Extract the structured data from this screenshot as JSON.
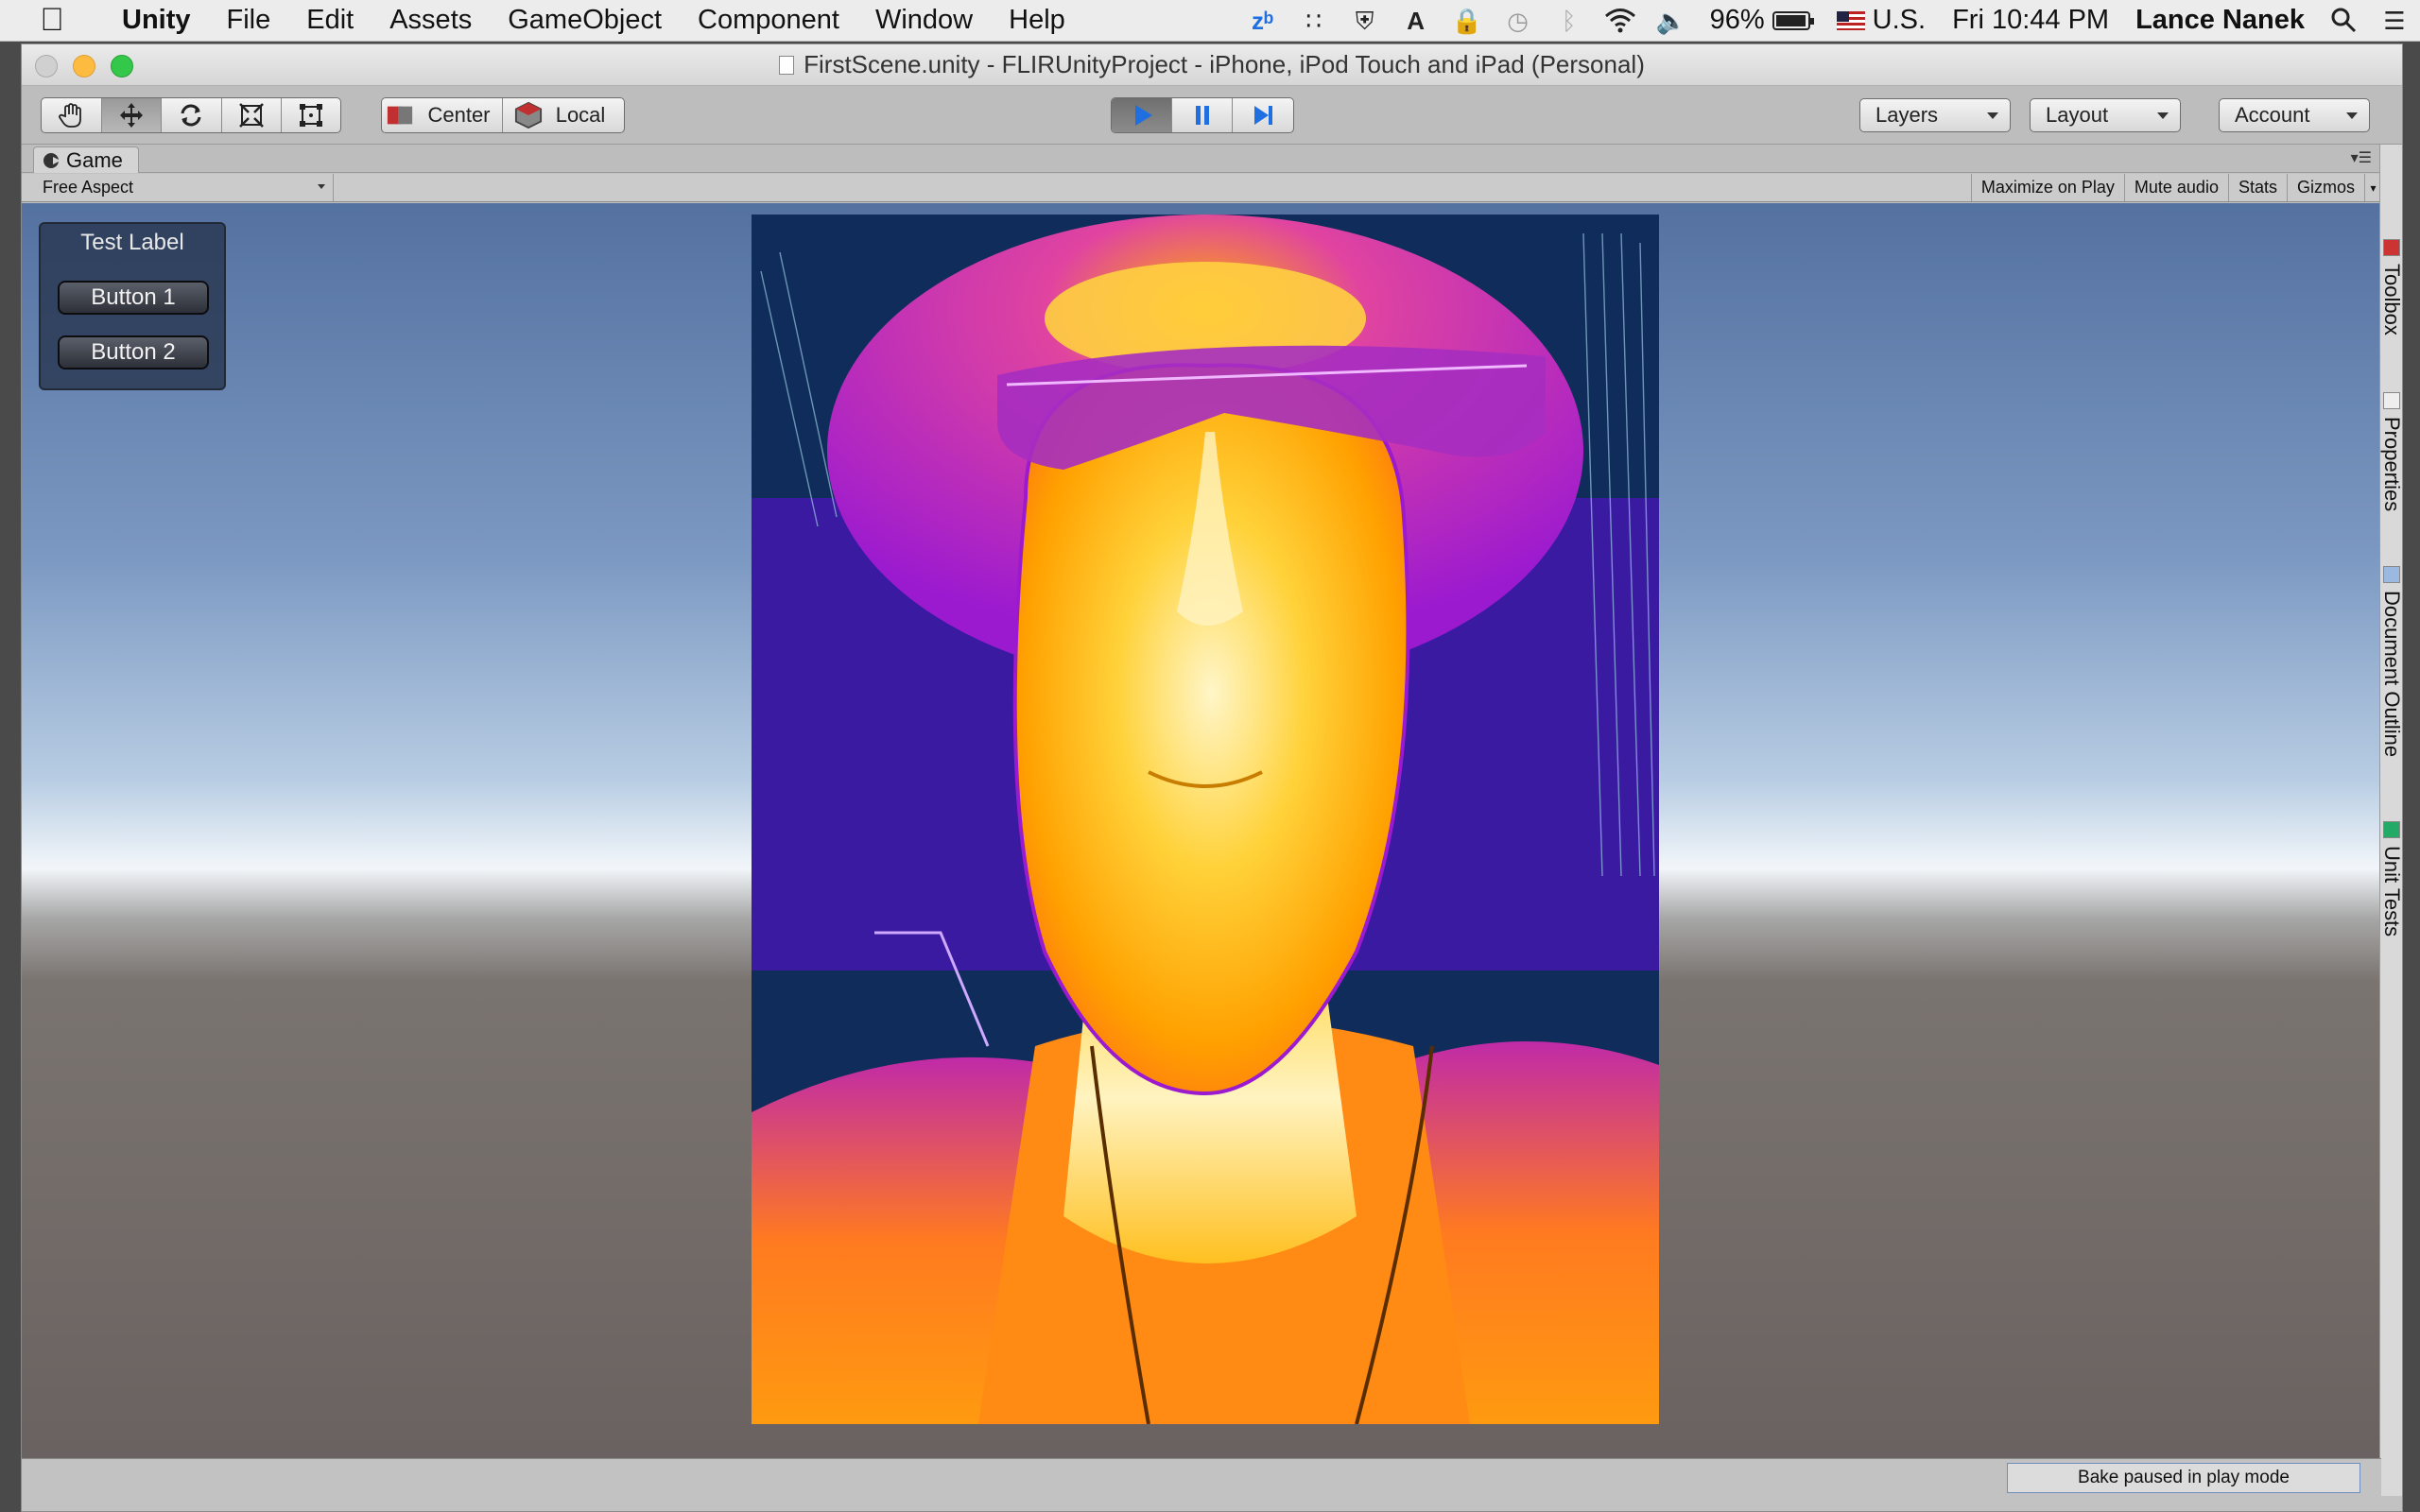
{
  "menubar": {
    "app_name": "Unity",
    "menus": [
      "File",
      "Edit",
      "Assets",
      "GameObject",
      "Component",
      "Window",
      "Help"
    ],
    "battery": "96%",
    "battery_level": 0.96,
    "input_source": "U.S.",
    "clock": "Fri 10:44 PM",
    "user": "Lance Nanek"
  },
  "window": {
    "title": "FirstScene.unity - FLIRUnityProject - iPhone, iPod Touch and iPad (Personal)"
  },
  "toolbar": {
    "pivot_mode": "Center",
    "pivot_rotation": "Local",
    "layers_label": "Layers",
    "layout_label": "Layout",
    "account_label": "Account"
  },
  "game_panel": {
    "tab_label": "Game",
    "aspect": "Free Aspect",
    "maximize_on_play": "Maximize on Play",
    "mute_audio": "Mute audio",
    "stats": "Stats",
    "gizmos": "Gizmos",
    "gui": {
      "label": "Test Label",
      "button_1": "Button 1",
      "button_2": "Button 2"
    }
  },
  "sidebar_tabs": [
    "Toolbox",
    "Properties",
    "Document Outline",
    "Unit Tests"
  ],
  "status": {
    "bake_message": "Bake paused in play mode"
  },
  "colors": {
    "play_accent": "#1f6fe0",
    "thermal_hot": "#fff4b8",
    "thermal_warm": "#ffb000",
    "thermal_mid": "#b81cc4",
    "thermal_cold": "#0f2a55"
  }
}
